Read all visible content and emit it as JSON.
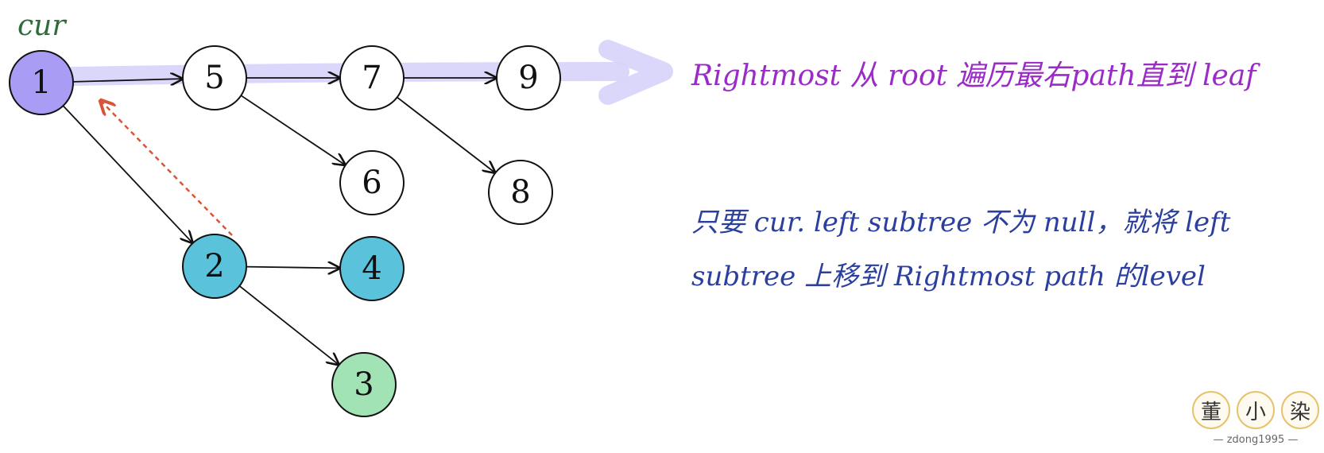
{
  "cur_label": "cur",
  "nodes": [
    {
      "id": "1",
      "label": "1",
      "fill": "#a89cf4"
    },
    {
      "id": "5",
      "label": "5",
      "fill": "#ffffff"
    },
    {
      "id": "7",
      "label": "7",
      "fill": "#ffffff"
    },
    {
      "id": "9",
      "label": "9",
      "fill": "#ffffff"
    },
    {
      "id": "6",
      "label": "6",
      "fill": "#ffffff"
    },
    {
      "id": "8",
      "label": "8",
      "fill": "#ffffff"
    },
    {
      "id": "2",
      "label": "2",
      "fill": "#5bc2dc"
    },
    {
      "id": "4",
      "label": "4",
      "fill": "#5bc2dc"
    },
    {
      "id": "3",
      "label": "3",
      "fill": "#a2e3b6"
    }
  ],
  "edges": [
    {
      "from": "1",
      "to": "5"
    },
    {
      "from": "5",
      "to": "7"
    },
    {
      "from": "7",
      "to": "9"
    },
    {
      "from": "5",
      "to": "6"
    },
    {
      "from": "7",
      "to": "8"
    },
    {
      "from": "1",
      "to": "2"
    },
    {
      "from": "2",
      "to": "4"
    },
    {
      "from": "2",
      "to": "3"
    }
  ],
  "notes": {
    "rightmost": "Rightmost 从 root 遍历最右path直到 leaf",
    "rule_line1": "只要 cur. left subtree 不为 null，就将 left",
    "rule_line2": "subtree 上移到 Rightmost path 的level"
  },
  "colors": {
    "cur": "#2f6b3a",
    "rightmost_note": "#9a2bc7",
    "rule_note": "#2a3f9e",
    "highlight": "#d7d3fb",
    "dashed_arrow": "#d9553a",
    "edge": "#111111"
  },
  "watermark": {
    "seal_1": "董",
    "seal_2": "小",
    "seal_3": "染",
    "handle": "— zdong1995 —"
  }
}
